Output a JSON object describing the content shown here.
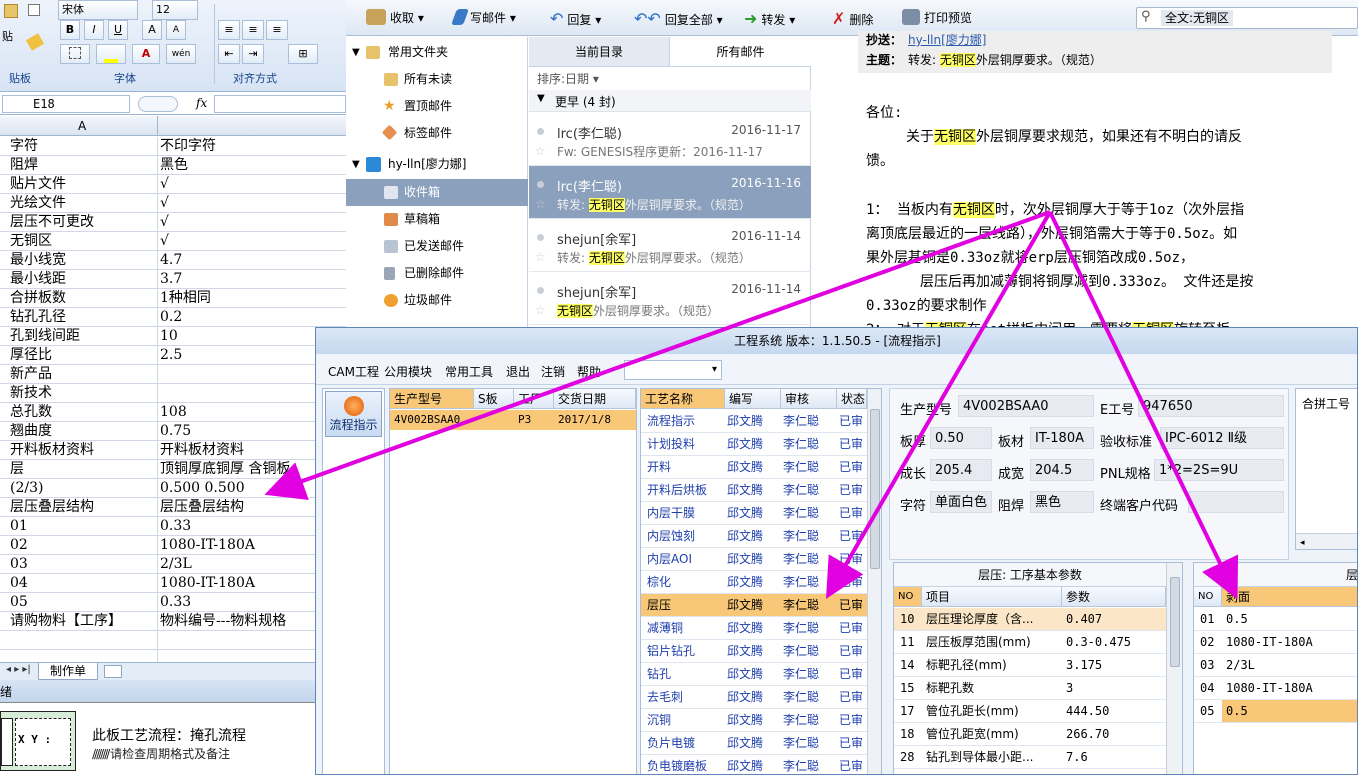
{
  "excel": {
    "ribbon": {
      "font_name": "宋体",
      "font_size": "12",
      "bold": "B",
      "italic": "I",
      "underline": "U",
      "grow_font": "A",
      "shrink_font": "A",
      "font_color_glyph": "A",
      "wen": "wén",
      "group_clipboard": "贴板",
      "group_font": "字体",
      "group_align": "对齐方式",
      "paste_short": "贴"
    },
    "name_box": "E18",
    "fx": "fx",
    "col_header": "A",
    "rows": [
      {
        "a": "字符",
        "b": "不印字符"
      },
      {
        "a": "阻焊",
        "b": "黑色"
      },
      {
        "a": "贴片文件",
        "b": "√"
      },
      {
        "a": "光绘文件",
        "b": "√"
      },
      {
        "a": "层压不可更改",
        "b": "√"
      },
      {
        "a": "无铜区",
        "b": "√"
      },
      {
        "a": "最小线宽",
        "b": "4.7"
      },
      {
        "a": "最小线距",
        "b": "3.7"
      },
      {
        "a": "合拼板数",
        "b": "1种相同"
      },
      {
        "a": "钻孔孔径",
        "b": "0.2"
      },
      {
        "a": "孔到线间距",
        "b": "10"
      },
      {
        "a": "厚径比",
        "b": "2.5"
      },
      {
        "a": "新产品",
        "b": ""
      },
      {
        "a": "新技术",
        "b": ""
      },
      {
        "a": "总孔数",
        "b": "108"
      },
      {
        "a": "翘曲度",
        "b": "0.75"
      },
      {
        "a": "开料板材资料",
        "b": "开料板材资料"
      },
      {
        "a": "层",
        "b": "顶铜厚底铜厚 含铜板"
      },
      {
        "a": "(2/3)",
        "b": "0.500  0.500"
      },
      {
        "a": "层压叠层结构",
        "b": "层压叠层结构"
      },
      {
        "a": "01",
        "b": "0.33"
      },
      {
        "a": "02",
        "b": "1080-IT-180A"
      },
      {
        "a": "03",
        "b": "2/3L"
      },
      {
        "a": "04",
        "b": "1080-IT-180A"
      },
      {
        "a": "05",
        "b": "0.33"
      },
      {
        "a": "请购物料【工序】",
        "b": "物料编号---物料规格"
      },
      {
        "a": "",
        "b": ""
      }
    ],
    "sheet_tab": "制作单",
    "status_label": "绪",
    "bottom_xy": "X Y :",
    "bottom_flow": "此板工艺流程：掩孔流程",
    "bottom_note": "请检查周期格式及备注"
  },
  "outlook": {
    "toolbar": {
      "receive": "收取",
      "write": "写邮件",
      "reply": "回复",
      "reply_all": "回复全部",
      "forward": "转发",
      "delete": "删除",
      "print_preview": "打印预览",
      "search_value": "全文:无铜区"
    },
    "nav": {
      "common_folders": "常用文件夹",
      "all_unread": "所有未读",
      "pinned": "置顶邮件",
      "tagged": "标签邮件",
      "account": "hy-lln[廖力娜]",
      "inbox": "收件箱",
      "drafts": "草稿箱",
      "sent": "已发送邮件",
      "deleted": "已删除邮件",
      "junk": "垃圾邮件"
    },
    "list": {
      "tab_current": "当前目录",
      "tab_all": "所有邮件",
      "sort": "排序:日期",
      "group": "更早 (4 封)",
      "mails": [
        {
          "from": "lrc(李仁聪)",
          "date": "2016-11-17",
          "pre": "Fw: GENESIS程序更新：2016-11-17",
          "hl": "",
          "post": ""
        },
        {
          "from": "lrc(李仁聪)",
          "date": "2016-11-16",
          "pre": "转发: ",
          "hl": "无铜区",
          "post": "外层铜厚要求。（规范）"
        },
        {
          "from": "shejun[余军]",
          "date": "2016-11-14",
          "pre": "转发: ",
          "hl": "无铜区",
          "post": "外层铜厚要求。（规范）"
        },
        {
          "from": "shejun[余军]",
          "date": "2016-11-14",
          "pre": "",
          "hl": "无铜区",
          "post": "外层铜厚要求。（规范）"
        }
      ]
    },
    "reading": {
      "cc_label": "抄送：",
      "cc_value": "hy-lln[廖力娜]",
      "subject_label": "主题：",
      "subject_pre": "转发: ",
      "subject_hl": "无铜区",
      "subject_post": "外层铜厚要求。（规范）",
      "greeting": "各位:",
      "p1_pre": "关于",
      "p1_hl": "无铜区",
      "p1_post": "外层铜厚要求规范，如果还有不明白的请反",
      "p1_line2": "馈。",
      "p2_a": "1：  当板内有",
      "p2_hl": "无铜区",
      "p2_b": "时，次外层铜厚大于等于1oz（次外层指",
      "p2_line2": "离顶底层最近的一层线路），外层铜箔需大于等于0.5oz。如",
      "p2_line3": "果外层基铜是0.33oz就将erp层压铜箔改成0.5oz，",
      "p2_line4": "层压后再加减薄铜将铜厚减到0.333oz。  文件还是按",
      "p2_line5": "0.33oz的要求制作",
      "p3_a": "2：  对于",
      "p3_hl": "无铜区",
      "p3_b": "在set拼板中间用，需要将",
      "p3_hl2": "无铜区",
      "p3_c": "旋转至板"
    }
  },
  "cam": {
    "title": "工程系统  版本：1.1.50.5 - [流程指示]",
    "menu": [
      "CAM工程",
      "公用模块",
      "常用工具",
      "退出",
      "注销",
      "帮助"
    ],
    "side_button": "流程指示",
    "prod_headers": [
      "生产型号",
      "S板",
      "工厂",
      "交货日期"
    ],
    "prod_row": {
      "model": "4V002BSAA0",
      "s": "",
      "factory": "P3",
      "date": "2017/1/8"
    },
    "proc_headers": [
      "工艺名称",
      "编写",
      "审核",
      "状态"
    ],
    "procs": [
      {
        "name": "流程指示",
        "writer": "邱文腾",
        "reviewer": "李仁聪",
        "status": "已审"
      },
      {
        "name": "计划投料",
        "writer": "邱文腾",
        "reviewer": "李仁聪",
        "status": "已审"
      },
      {
        "name": "开料",
        "writer": "邱文腾",
        "reviewer": "李仁聪",
        "status": "已审"
      },
      {
        "name": "开料后烘板",
        "writer": "邱文腾",
        "reviewer": "李仁聪",
        "status": "已审"
      },
      {
        "name": "内层干膜",
        "writer": "邱文腾",
        "reviewer": "李仁聪",
        "status": "已审"
      },
      {
        "name": "内层蚀刻",
        "writer": "邱文腾",
        "reviewer": "李仁聪",
        "status": "已审"
      },
      {
        "name": "内层AOI",
        "writer": "邱文腾",
        "reviewer": "李仁聪",
        "status": "已审"
      },
      {
        "name": "棕化",
        "writer": "邱文腾",
        "reviewer": "李仁聪",
        "status": "已审"
      },
      {
        "name": "层压",
        "writer": "邱文腾",
        "reviewer": "李仁聪",
        "status": "已审"
      },
      {
        "name": "减薄铜",
        "writer": "邱文腾",
        "reviewer": "李仁聪",
        "status": "已审"
      },
      {
        "name": "铝片钻孔",
        "writer": "邱文腾",
        "reviewer": "李仁聪",
        "status": "已审"
      },
      {
        "name": "钻孔",
        "writer": "邱文腾",
        "reviewer": "李仁聪",
        "status": "已审"
      },
      {
        "name": "去毛刺",
        "writer": "邱文腾",
        "reviewer": "李仁聪",
        "status": "已审"
      },
      {
        "name": "沉铜",
        "writer": "邱文腾",
        "reviewer": "李仁聪",
        "status": "已审"
      },
      {
        "name": "负片电镀",
        "writer": "邱文腾",
        "reviewer": "李仁聪",
        "status": "已审"
      },
      {
        "name": "负电镀磨板",
        "writer": "邱文腾",
        "reviewer": "李仁聪",
        "status": "已审"
      }
    ],
    "info": {
      "model_label": "生产型号",
      "model": "4V002BSAA0",
      "worker_label": "E工号",
      "worker": "947650",
      "thick_label": "板厚",
      "thick": "0.50",
      "mat_label": "板材",
      "mat": "IT-180A",
      "std_label": "验收标准",
      "std": "IPC-6012 Ⅱ级",
      "len_label": "成长",
      "len": "205.4",
      "wid_label": "成宽",
      "wid": "204.5",
      "pnl_label": "PNL规格",
      "pnl": "1*2=2S=9U",
      "char_label": "字符",
      "char": "单面白色",
      "mask_label": "阻焊",
      "mask": "黑色",
      "cust_label": "终端客户代码",
      "cust": ""
    },
    "merge_header": "合拼工号",
    "params": {
      "title": "层压: 工序基本参数",
      "headers": [
        "NO",
        "项目",
        "参数"
      ],
      "rows": [
        {
          "no": "10",
          "item": "层压理论厚度（含...",
          "val": "0.407"
        },
        {
          "no": "11",
          "item": "层压板厚范围(mm)",
          "val": "0.3-0.475"
        },
        {
          "no": "14",
          "item": "标靶孔径(mm)",
          "val": "3.175"
        },
        {
          "no": "15",
          "item": "标靶孔数",
          "val": "3"
        },
        {
          "no": "17",
          "item": "管位孔距长(mm)",
          "val": "444.50"
        },
        {
          "no": "18",
          "item": "管位孔距宽(mm)",
          "val": "266.70"
        },
        {
          "no": "28",
          "item": "钻孔到导体最小距...",
          "val": "7.6"
        }
      ]
    },
    "layer": {
      "title": "层",
      "headers": [
        "NO",
        "剥面"
      ],
      "rows": [
        {
          "no": "01",
          "val": "0.5"
        },
        {
          "no": "02",
          "val": "1080-IT-180A"
        },
        {
          "no": "03",
          "val": "2/3L"
        },
        {
          "no": "04",
          "val": "1080-IT-180A"
        },
        {
          "no": "05",
          "val": "0.5"
        }
      ]
    }
  },
  "colors": {
    "arrow": "#e000e0",
    "highlight": "#ffff66",
    "selected_row": "#f8c878",
    "link_blue": "#1f3fae",
    "selected_mail": "#8aa0bd"
  }
}
